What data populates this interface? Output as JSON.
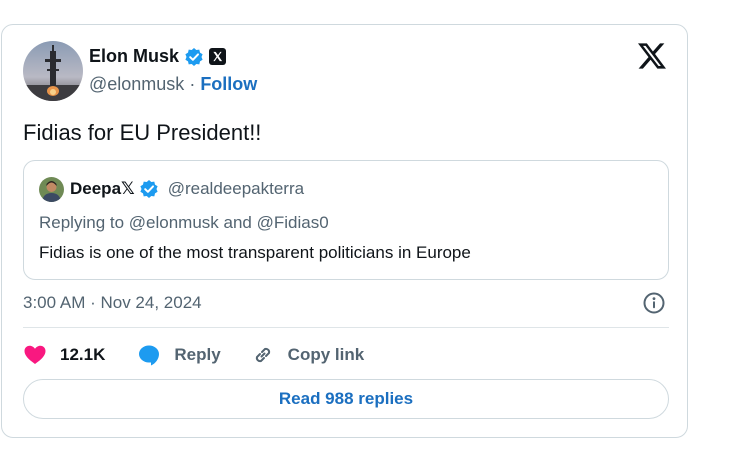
{
  "tweet": {
    "author_name": "Elon Musk",
    "author_handle": "@elonmusk",
    "separator": "·",
    "follow_label": "Follow",
    "text": "Fidias for EU President!!",
    "timestamp": "3:00 AM · Nov 24, 2024"
  },
  "quote": {
    "author_name": "Deepa𝕏",
    "author_handle": "@realdeepakterra",
    "replying_to": "Replying to @elonmusk and @Fidias0",
    "text": "Fidias is one of the most transparent politicians in Europe"
  },
  "actions": {
    "like_count": "12.1K",
    "reply_label": "Reply",
    "copy_link_label": "Copy link"
  },
  "read_replies_label": "Read 988 replies",
  "icons": [
    "verified-badge-icon",
    "x-affiliate-icon",
    "x-logo-icon",
    "info-icon",
    "heart-icon",
    "reply-bubble-icon",
    "link-icon"
  ],
  "colors": {
    "verified_blue": "#1d9bf0",
    "heart_pink": "#f91880",
    "link_blue": "#1b6fc0",
    "text": "#0f1419",
    "muted": "#536471"
  }
}
